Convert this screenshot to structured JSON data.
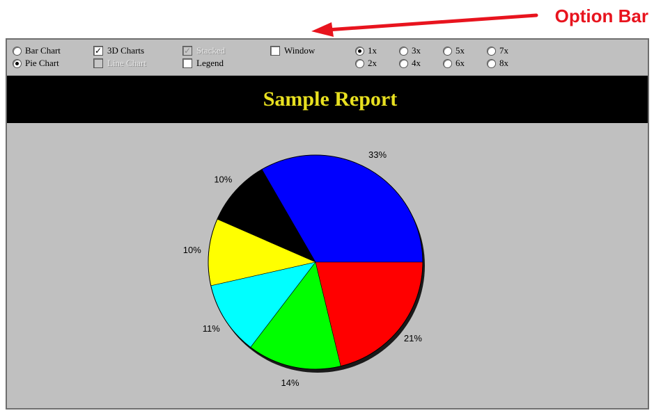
{
  "callout": {
    "label": "Option Bar"
  },
  "options": {
    "chart_type": [
      {
        "label": "Bar Chart",
        "selected": false
      },
      {
        "label": "Pie Chart",
        "selected": true
      }
    ],
    "checks": [
      {
        "label": "3D Charts",
        "checked": true,
        "enabled": true
      },
      {
        "label": "Stacked",
        "checked": true,
        "enabled": false
      },
      {
        "label": "Window",
        "checked": false,
        "enabled": true
      },
      {
        "label": "Line Chart",
        "checked": false,
        "enabled": false
      },
      {
        "label": "Legend",
        "checked": false,
        "enabled": true
      }
    ],
    "scale": [
      {
        "label": "1x",
        "selected": true
      },
      {
        "label": "3x",
        "selected": false
      },
      {
        "label": "5x",
        "selected": false
      },
      {
        "label": "7x",
        "selected": false
      },
      {
        "label": "2x",
        "selected": false
      },
      {
        "label": "4x",
        "selected": false
      },
      {
        "label": "6x",
        "selected": false
      },
      {
        "label": "8x",
        "selected": false
      }
    ]
  },
  "report": {
    "title": "Sample Report"
  },
  "colors": {
    "title_text": "#e8e020",
    "background": "#c0c0c0",
    "callout": "#e8141e"
  },
  "chart_data": {
    "type": "pie",
    "title": "",
    "slices": [
      {
        "label": "33%",
        "value": 33,
        "color": "#0000ff"
      },
      {
        "label": "10%",
        "value": 10,
        "color": "#000000"
      },
      {
        "label": "10%",
        "value": 10,
        "color": "#ffff00"
      },
      {
        "label": "11%",
        "value": 11,
        "color": "#00ffff"
      },
      {
        "label": "14%",
        "value": 14,
        "color": "#00ff00"
      },
      {
        "label": "21%",
        "value": 21,
        "color": "#ff0000"
      }
    ]
  }
}
